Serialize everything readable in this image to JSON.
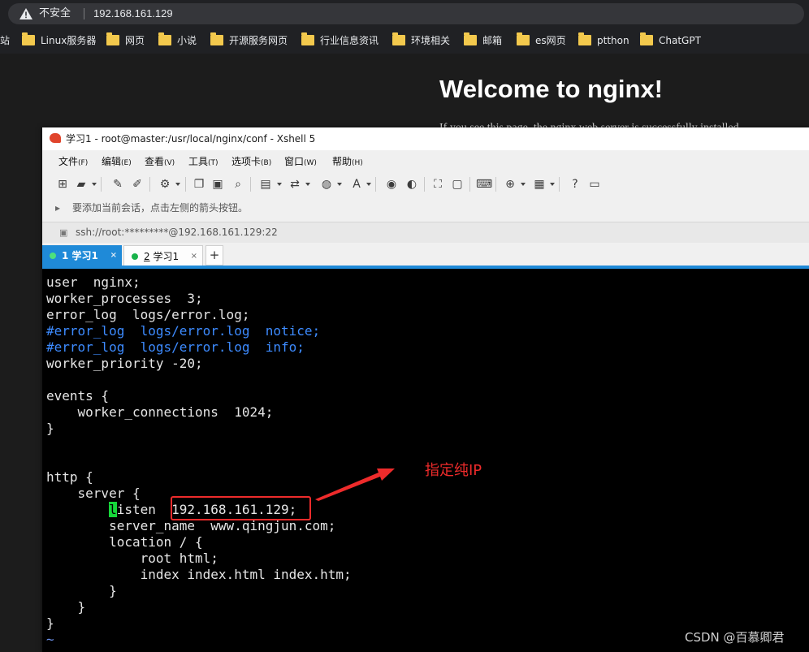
{
  "browser": {
    "security_label": "不安全",
    "url": "192.168.161.129",
    "bookmarks": [
      {
        "label": "站"
      },
      {
        "label": "Linux服务器"
      },
      {
        "label": "网页"
      },
      {
        "label": "小说"
      },
      {
        "label": "开源服务网页"
      },
      {
        "label": "行业信息资讯"
      },
      {
        "label": "环境相关"
      },
      {
        "label": "邮箱"
      },
      {
        "label": "es网页"
      },
      {
        "label": "ptthon"
      },
      {
        "label": "ChatGPT"
      }
    ]
  },
  "page": {
    "heading": "Welcome to nginx!",
    "subtext": "If you see this page, the nginx web server is successfully installed"
  },
  "xshell": {
    "title": "学习1 - root@master:/usr/local/nginx/conf - Xshell 5",
    "menu": [
      {
        "label": "文件",
        "accel": "(F)"
      },
      {
        "label": "编辑",
        "accel": "(E)"
      },
      {
        "label": "查看",
        "accel": "(V)"
      },
      {
        "label": "工具",
        "accel": "(T)"
      },
      {
        "label": "选项卡",
        "accel": "(B)"
      },
      {
        "label": "窗口",
        "accel": "(W)"
      },
      {
        "label": "帮助",
        "accel": "(H)"
      }
    ],
    "hint": "要添加当前会话，点击左侧的箭头按钮。",
    "session": "ssh://root:*********@192.168.161.129:22",
    "tabs": [
      {
        "num": "1",
        "label": "学习1",
        "close": "×"
      },
      {
        "num": "2",
        "label": "学习1",
        "close": "×"
      }
    ],
    "tab_add": "+"
  },
  "terminal": {
    "lines": [
      "user  nginx;",
      "worker_processes  3;",
      "error_log  logs/error.log;",
      "#error_log  logs/error.log  notice;",
      "#error_log  logs/error.log  info;",
      "worker_priority -20;",
      "",
      "events {",
      "    worker_connections  1024;",
      "}",
      "",
      "",
      "http {",
      "    server {",
      "        listen  192.168.161.129;",
      "        server_name  www.qingjun.com;",
      "        location / {",
      "            root html;",
      "            index index.html index.htm;",
      "        }",
      "    }",
      "}",
      "~"
    ],
    "cursor_char": "l",
    "cursor_line_rest": "isten  192.168.161.129;",
    "cursor_line_indent": "        "
  },
  "annotation": {
    "text": "指定纯IP",
    "color": "#ee2b2b"
  },
  "watermark": "CSDN @百慕卿君",
  "colors": {
    "tab_active": "#1f8ad8",
    "comment": "#3d8bff",
    "cursor": "#16d63a",
    "annotation": "#ee2b2b"
  }
}
